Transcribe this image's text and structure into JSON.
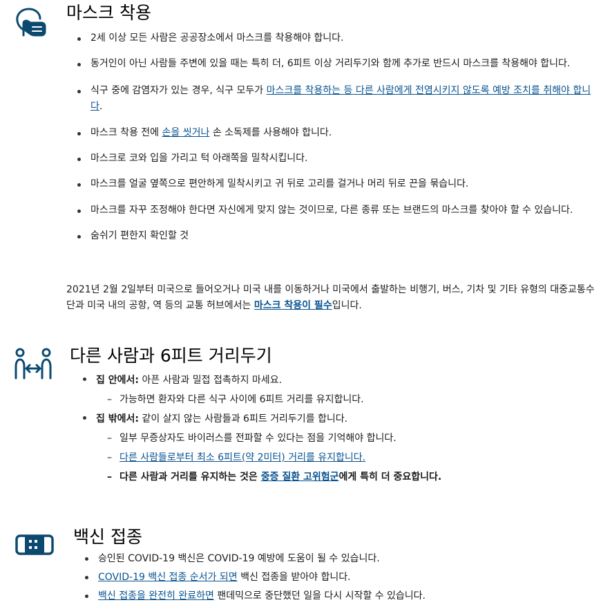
{
  "sections": {
    "mask": {
      "icon": "face-mask-icon",
      "title": "마스크 착용",
      "items": {
        "0": {
          "text": "2세 이상 모든 사람은 공공장소에서 마스크를 착용해야 합니다."
        },
        "1": {
          "text": "동거인이 아닌 사람들 주변에 있을 때는 특히 더, 6피트 이상 거리두기와 함께 추가로 반드시 마스크를 착용해야 합니다."
        },
        "2": {
          "before": "식구 중에 감염자가 있는 경우, 식구 모두가 ",
          "link": "마스크를 착용하는 등 다른 사람에게 전염시키지 않도록 예방 조치를 취해야 합니다",
          "after": "."
        },
        "3": {
          "before": "마스크 착용 전에 ",
          "link": "손을 씻거나",
          "after": " 손 소독제를 사용해야 합니다."
        },
        "4": {
          "text": "마스크로 코와 입을 가리고 턱 아래쪽을 밀착시킵니다."
        },
        "5": {
          "text": "마스크를 얼굴 옆쪽으로 편안하게 밀착시키고 귀 뒤로 고리를 걸거나 머리 뒤로 끈을 묶습니다."
        },
        "6": {
          "text": "마스크를 자꾸 조정해야 한다면 자신에게 맞지 않는 것이므로, 다른 종류 또는 브랜드의 마스크를 찾아야 할 수 있습니다."
        },
        "7": {
          "text": "숨쉬기 편한지 확인할 것"
        }
      },
      "note": {
        "before": "2021년 2월 2일부터 미국으로 들어오거나 미국 내를 이동하거나 미국에서 출발하는 비행기, 버스, 기차 및 기타 유형의 대중교통수단과 미국 내의 공항, 역 등의 교통 허브에서는 ",
        "link": "마스크 착용이 필수",
        "after": "입니다."
      }
    },
    "distance": {
      "icon": "social-distance-icon",
      "title": "다른 사람과 6피트 거리두기",
      "home": {
        "label": "집 안에서:",
        "text": " 아픈 사람과 밀접 접촉하지 마세요.",
        "sub": {
          "0": {
            "text": "가능하면 환자와 다른 식구 사이에 6피트 거리를 유지합니다."
          }
        }
      },
      "outside": {
        "label": "집 밖에서:",
        "text": " 같이 살지 않는 사람들과 6피트 거리두기를 합니다.",
        "sub": {
          "0": {
            "text": "일부 무증상자도 바이러스를 전파할 수 있다는 점을 기억해야 합니다."
          },
          "1": {
            "link": "다른 사람들로부터 최소 6피트(약 2미터) 거리를 유지합니다."
          },
          "2": {
            "before": "다른 사람과 거리를 유지하는 것은 ",
            "link": "중증 질환 고위험군",
            "after": "에게 특히 더 중요합니다."
          }
        }
      }
    },
    "vaccine": {
      "icon": "bandage-icon",
      "title": "백신 접종",
      "items": {
        "0": {
          "text": "승인된 COVID-19 백신은 COVID-19 예방에 도움이 될 수 있습니다."
        },
        "1": {
          "link": "COVID-19 백신 접종 순서가 되면",
          "after": " 백신 접종을 받아야 합니다."
        },
        "2": {
          "link": "백신 접종을 완전히 완료하면",
          "after": " 팬데믹으로 중단했던 일을 다시 시작할 수 있습니다."
        }
      }
    }
  },
  "colors": {
    "accent": "#075290",
    "icon": "#0b4a6f",
    "text": "#1a1a1a"
  }
}
